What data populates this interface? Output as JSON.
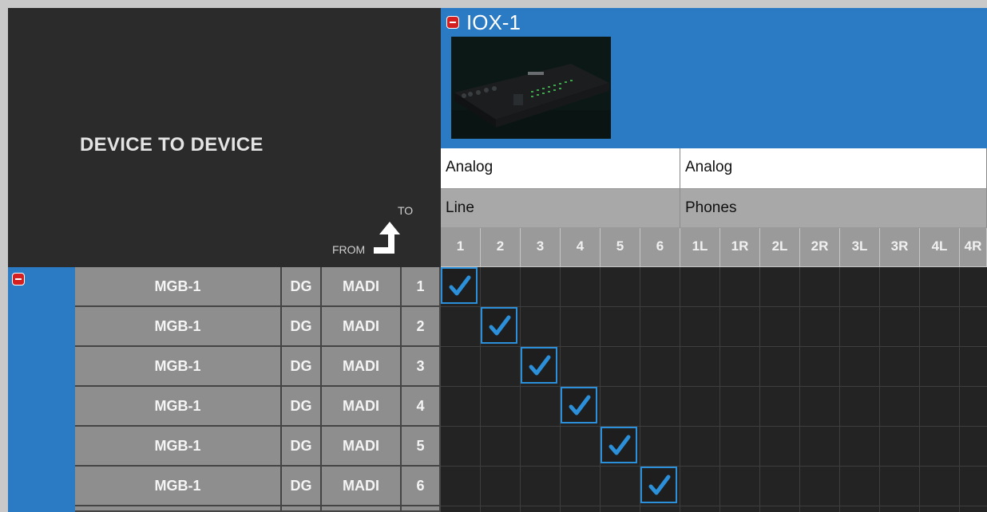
{
  "matrix": {
    "title": "DEVICE TO DEVICE",
    "to_label": "TO",
    "from_label": "FROM"
  },
  "destination_device": {
    "name": "IOX-1",
    "photo_icon": "audio-interface-photo",
    "banks": [
      {
        "type": "Analog",
        "subtype": "Line",
        "channels": [
          "1",
          "2",
          "3",
          "4",
          "5",
          "6"
        ]
      },
      {
        "type": "Analog",
        "subtype": "Phones",
        "channels": [
          "1L",
          "1R",
          "2L",
          "2R",
          "3L",
          "3R",
          "4L",
          "4R"
        ]
      }
    ]
  },
  "source_rows": [
    {
      "device": "MGB-1",
      "type": "DG",
      "port": "MADI",
      "channel": "1",
      "routed_to_column": 0
    },
    {
      "device": "MGB-1",
      "type": "DG",
      "port": "MADI",
      "channel": "2",
      "routed_to_column": 1
    },
    {
      "device": "MGB-1",
      "type": "DG",
      "port": "MADI",
      "channel": "3",
      "routed_to_column": 2
    },
    {
      "device": "MGB-1",
      "type": "DG",
      "port": "MADI",
      "channel": "4",
      "routed_to_column": 3
    },
    {
      "device": "MGB-1",
      "type": "DG",
      "port": "MADI",
      "channel": "5",
      "routed_to_column": 4
    },
    {
      "device": "MGB-1",
      "type": "DG",
      "port": "MADI",
      "channel": "6",
      "routed_to_column": 5
    }
  ],
  "colors": {
    "accent_blue": "#2a7ac4",
    "check_blue": "#2b90d9",
    "remove_red": "#d42020"
  }
}
